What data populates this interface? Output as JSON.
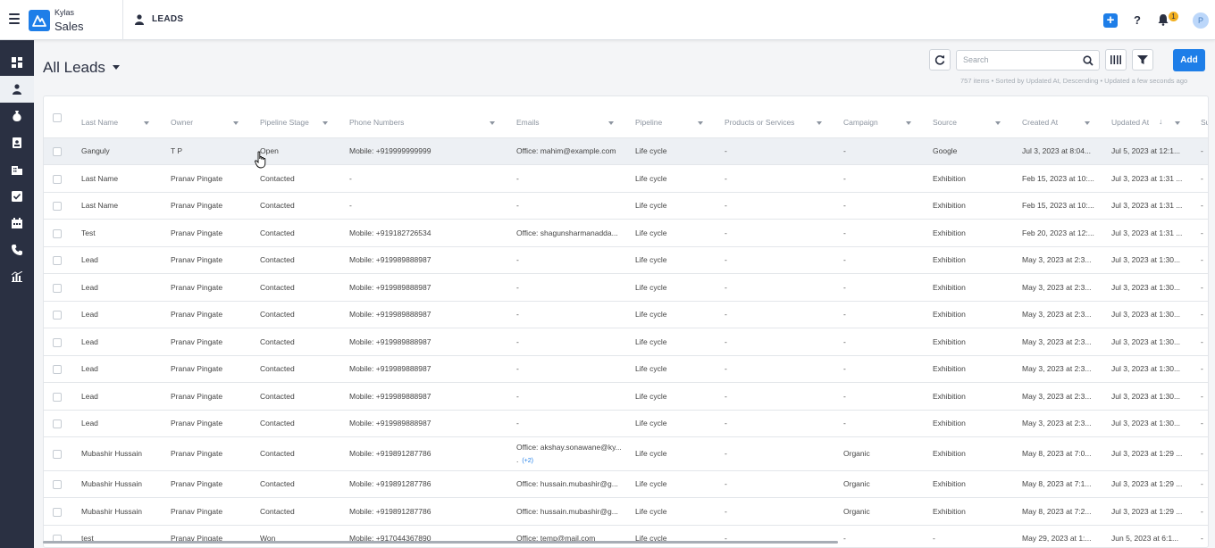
{
  "app": {
    "brand_top": "Kylas",
    "brand_main": "Sales",
    "module": "LEADS",
    "notification_count": "1",
    "avatar_initial": "P",
    "accent": "#1e7ee8"
  },
  "sidebar": {
    "items": [
      "dashboard-icon",
      "leads-icon",
      "deals-icon",
      "contacts-icon",
      "companies-icon",
      "tasks-icon",
      "calendar-icon",
      "calls-icon",
      "reports-icon"
    ]
  },
  "header": {
    "title": "All Leads",
    "search_placeholder": "Search",
    "add_label": "Add",
    "meta": "757 items • Sorted by Updated At, Descending • Updated a few seconds ago"
  },
  "table": {
    "columns": [
      "Last Name",
      "Owner",
      "Pipeline Stage",
      "Phone Numbers",
      "Emails",
      "Pipeline",
      "Products or Services",
      "Campaign",
      "Source",
      "Created At",
      "Updated At",
      "Su"
    ],
    "rows": [
      [
        "Ganguly",
        "T P",
        "Open",
        "Mobile: +919999999999",
        "Office: mahim@example.com",
        "Life cycle",
        "-",
        "-",
        "Google",
        "Jul 3, 2023 at 8:04...",
        "Jul 5, 2023 at 12:1...",
        "-"
      ],
      [
        "Last Name",
        "Pranav Pingate",
        "Contacted",
        "-",
        "-",
        "Life cycle",
        "-",
        "-",
        "Exhibition",
        "Feb 15, 2023 at 10:...",
        "Jul 3, 2023 at 1:31 ...",
        "-"
      ],
      [
        "Last Name",
        "Pranav Pingate",
        "Contacted",
        "-",
        "-",
        "Life cycle",
        "-",
        "-",
        "Exhibition",
        "Feb 15, 2023 at 10:...",
        "Jul 3, 2023 at 1:31 ...",
        "-"
      ],
      [
        "Test",
        "Pranav Pingate",
        "Contacted",
        "Mobile: +919182726534",
        "Office: shagunsharmanadda...",
        "Life cycle",
        "-",
        "-",
        "Exhibition",
        "Feb 20, 2023 at 12:...",
        "Jul 3, 2023 at 1:31 ...",
        "-"
      ],
      [
        "Lead",
        "Pranav Pingate",
        "Contacted",
        "Mobile: +919989888987",
        "-",
        "Life cycle",
        "-",
        "-",
        "Exhibition",
        "May 3, 2023 at 2:3...",
        "Jul 3, 2023 at 1:30...",
        "-"
      ],
      [
        "Lead",
        "Pranav Pingate",
        "Contacted",
        "Mobile: +919989888987",
        "-",
        "Life cycle",
        "-",
        "-",
        "Exhibition",
        "May 3, 2023 at 2:3...",
        "Jul 3, 2023 at 1:30...",
        "-"
      ],
      [
        "Lead",
        "Pranav Pingate",
        "Contacted",
        "Mobile: +919989888987",
        "-",
        "Life cycle",
        "-",
        "-",
        "Exhibition",
        "May 3, 2023 at 2:3...",
        "Jul 3, 2023 at 1:30...",
        "-"
      ],
      [
        "Lead",
        "Pranav Pingate",
        "Contacted",
        "Mobile: +919989888987",
        "-",
        "Life cycle",
        "-",
        "-",
        "Exhibition",
        "May 3, 2023 at 2:3...",
        "Jul 3, 2023 at 1:30...",
        "-"
      ],
      [
        "Lead",
        "Pranav Pingate",
        "Contacted",
        "Mobile: +919989888987",
        "-",
        "Life cycle",
        "-",
        "-",
        "Exhibition",
        "May 3, 2023 at 2:3...",
        "Jul 3, 2023 at 1:30...",
        "-"
      ],
      [
        "Lead",
        "Pranav Pingate",
        "Contacted",
        "Mobile: +919989888987",
        "-",
        "Life cycle",
        "-",
        "-",
        "Exhibition",
        "May 3, 2023 at 2:3...",
        "Jul 3, 2023 at 1:30...",
        "-"
      ],
      [
        "Lead",
        "Pranav Pingate",
        "Contacted",
        "Mobile: +919989888987",
        "-",
        "Life cycle",
        "-",
        "-",
        "Exhibition",
        "May 3, 2023 at 2:3...",
        "Jul 3, 2023 at 1:30...",
        "-"
      ],
      [
        "Mubashir Hussain",
        "Pranav Pingate",
        "Contacted",
        "Mobile: +919891287786",
        "Office: akshay.sonawane@ky...",
        "Life cycle",
        "-",
        "Organic",
        "Exhibition",
        "May 8, 2023 at 7:0...",
        "Jul 3, 2023 at 1:29 ...",
        "-"
      ],
      [
        "Mubashir Hussain",
        "Pranav Pingate",
        "Contacted",
        "Mobile: +919891287786",
        "Office: hussain.mubashir@g...",
        "Life cycle",
        "-",
        "Organic",
        "Exhibition",
        "May 8, 2023 at 7:1...",
        "Jul 3, 2023 at 1:29 ...",
        "-"
      ],
      [
        "Mubashir Hussain",
        "Pranav Pingate",
        "Contacted",
        "Mobile: +919891287786",
        "Office: hussain.mubashir@g...",
        "Life cycle",
        "-",
        "Organic",
        "Exhibition",
        "May 8, 2023 at 7:2...",
        "Jul 3, 2023 at 1:29 ...",
        "-"
      ],
      [
        "test",
        "Pranav Pingate",
        "Won",
        "Mobile: +917044367890",
        "Office: temp@mail.com",
        "Life cycle",
        "-",
        "-",
        "-",
        "May 29, 2023 at 1:...",
        "Jun 5, 2023 at 6:1...",
        "-"
      ]
    ],
    "extra_email_suffix": ".",
    "extra_email_count": "(+2)"
  }
}
